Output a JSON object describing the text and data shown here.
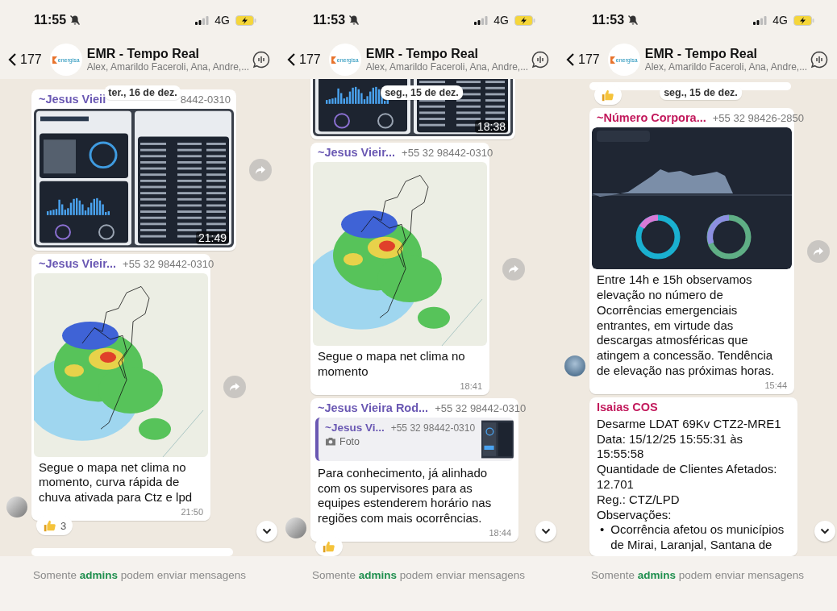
{
  "panels": [
    {
      "status": {
        "time": "11:55",
        "network": "4G"
      },
      "header": {
        "back_count": "177",
        "logo_text": "energisa",
        "title": "EMR - Tempo Real",
        "members": "Alex, Amarildo Faceroli, Ana, Andre,..."
      },
      "sticky_date": "ter., 16 de dez.",
      "items": [
        {
          "kind": "message",
          "sender": "~Jesus Vieii",
          "color": "#6a58b3",
          "phone": "8442-0310",
          "media": {
            "kind": "dashboard",
            "time": "21:49"
          },
          "forward": true
        },
        {
          "kind": "message",
          "sender": "~Jesus Vieir...",
          "color": "#6a58b3",
          "phone": "+55 32 98442-0310",
          "media": {
            "kind": "map"
          },
          "text": "Segue o mapa net clima no momento, curva rápida de chuva ativada para Ctz e lpd",
          "time": "21:50",
          "avatar": {
            "kind": "sketch"
          },
          "forward": true,
          "reaction": {
            "kind": "thumbs_up",
            "count": "3"
          }
        },
        {
          "kind": "cut"
        }
      ],
      "footer": {
        "before": "Somente",
        "highlight": "admins",
        "after": "podem enviar mensagens"
      }
    },
    {
      "status": {
        "time": "11:53",
        "network": "4G"
      },
      "header": {
        "back_count": "177",
        "logo_text": "energisa",
        "title": "EMR - Tempo Real",
        "members": "Alex, Amarildo Faceroli, Ana, Andre,..."
      },
      "sticky_date": "seg., 15 de dez.",
      "items": [
        {
          "kind": "message",
          "media": {
            "kind": "dashboard",
            "time": "18:38"
          }
        },
        {
          "kind": "message",
          "sender": "~Jesus Vieir...",
          "color": "#6a58b3",
          "phone": "+55 32 98442-0310",
          "media": {
            "kind": "map"
          },
          "text": "Segue o mapa net clima no momento",
          "time": "18:41",
          "forward": true
        },
        {
          "kind": "message",
          "sender": "~Jesus Vieira Rod...",
          "color": "#6a58b3",
          "phone": "+55 32 98442-0310",
          "quote": {
            "sender": "~Jesus Vi...",
            "color": "#6a58b3",
            "phone": "+55 32 98442-0310",
            "label": "Foto"
          },
          "text": "Para conhecimento, já alinhado com os supervisores para as equipes estenderem horário nas regiões com mais ocorrências.",
          "time": "18:44",
          "avatar": {
            "kind": "sketch"
          },
          "reaction": {
            "kind": "thumbs_up"
          }
        }
      ],
      "footer": {
        "before": "Somente",
        "highlight": "admins",
        "after": "podem enviar mensagens"
      }
    },
    {
      "status": {
        "time": "11:53",
        "network": "4G"
      },
      "header": {
        "back_count": "177",
        "logo_text": "energisa",
        "title": "EMR - Tempo Real",
        "members": "Alex, Amarildo Faceroli, Ana, Andre,..."
      },
      "sticky_date": "seg., 15 de dez.",
      "items": [
        {
          "kind": "cut",
          "reaction": {
            "kind": "thumbs_up"
          }
        },
        {
          "kind": "message",
          "sender": "~Número Corpora...",
          "color": "#c2185b",
          "phone": "+55 32 98426-2850",
          "media": {
            "kind": "chart"
          },
          "text": "Entre 14h e 15h observamos elevação no número de Ocorrências emergenciais entrantes, em virtude das descargas atmosféricas que atingem a concessão. Tendência de elevação nas próximas horas.",
          "time": "15:44",
          "avatar": {
            "kind": "photo"
          },
          "forward": true
        },
        {
          "kind": "message",
          "sender": "Isaias COS",
          "color": "#c2185b",
          "lines": [
            "Desarme LDAT 69Kv CTZ2-MRE1",
            "Data: 15/12/25 15:55:31 às 15:55:58",
            "Quantidade de Clientes Afetados: 12.701",
            "Reg.: CTZ/LPD",
            "Observações:"
          ],
          "bullets": [
            {
              "bullet": "•",
              "text": "Ocorrência afetou os municípios de Mirai, Laranjal, Santana de"
            }
          ]
        }
      ],
      "footer": {
        "before": "Somente",
        "highlight": "admins",
        "after": "podem enviar mensagens"
      }
    }
  ]
}
